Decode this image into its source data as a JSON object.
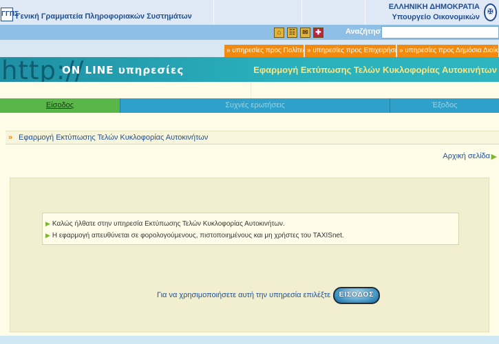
{
  "header": {
    "logo_text": "ΓΓΠΣ",
    "title": "Γενική Γραμματεία Πληροφοριακών Συστημάτων",
    "country": "ΕΛΛΗΝΙΚΗ ΔΗΜΟΚΡΑΤΙΑ",
    "ministry": "Υπουργείο Οικονομικών"
  },
  "searchbar": {
    "icons": [
      "home-icon",
      "sitemap-icon",
      "contact-icon",
      "english-flag-icon"
    ],
    "label": "Αναζήτηση",
    "value": ""
  },
  "services": [
    {
      "label": "» υπηρεσίες προς Πολίτες"
    },
    {
      "label": "» υπηρεσίες προς Επιχειρήσεις"
    },
    {
      "label": "» υπηρεσίες προς Δημόσια Διοίκηση"
    }
  ],
  "banner": {
    "http": "http://",
    "online": "ON LINE υπηρεσίες",
    "app_title": "Εφαρμογή Εκτύπωσης Τελών Κυκλοφορίας Αυτοκινήτων"
  },
  "nav": {
    "enter": "Είσοδος",
    "faq": "Συχνές ερωτήσεις",
    "exit": "Έξοδος"
  },
  "page": {
    "heading": "Εφαρμογή Εκτύπωσης Τελών Κυκλοφορίας Αυτοκινήτων",
    "home_link": "Αρχική σελίδα",
    "info_lines": [
      "Καλώς ήλθατε στην υπηρεσία Εκτύπωσης Τελών Κυκλοφορίας Αυτοκινήτων.",
      "Η εφαρμογή απευθύνεται σε φορολογούμενους, πιστοποιημένους και μη χρήστες του TAXISnet."
    ],
    "use_text": "Για να χρησιμοποιήσετε αυτή την υπηρεσία επιλέξτε :",
    "enter_button": "ΕΙΣΟΔΟΣ"
  },
  "colors": {
    "accent_blue": "#1f4f92",
    "service_orange": "#f28a0f",
    "banner_teal": "#2ab0bc",
    "nav_green": "#58b748",
    "nav_blue": "#2ea0c9"
  }
}
